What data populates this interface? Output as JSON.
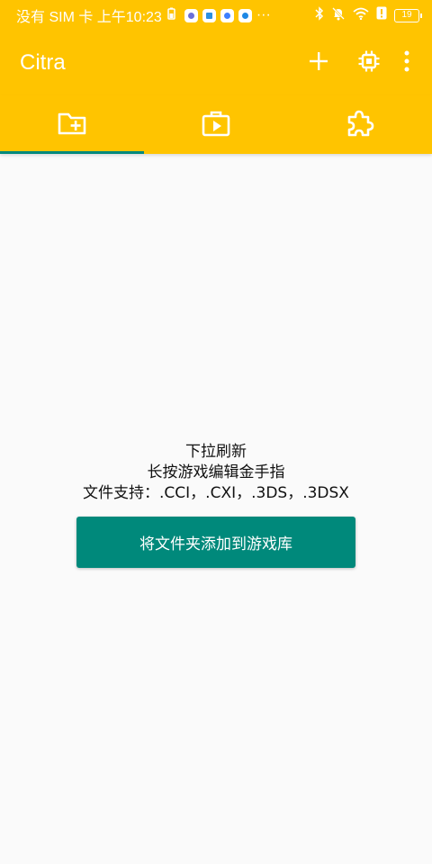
{
  "status_bar": {
    "carrier_time": "没有 SIM 卡 上午10:23",
    "more": "···",
    "battery_level": "19",
    "icons_left": [
      "music-app-icon",
      "book-app-icon",
      "browser-app-icon",
      "bulb-app-icon"
    ],
    "icons_right": [
      "bluetooth-icon",
      "mute-icon",
      "wifi-icon",
      "alert-icon",
      "battery-icon"
    ]
  },
  "app_bar": {
    "title": "Citra",
    "actions": [
      "add-icon",
      "chip-icon",
      "more-vert-icon"
    ]
  },
  "tabs": [
    {
      "name": "tab-games-folder",
      "icon": "folder-add-icon",
      "active": true
    },
    {
      "name": "tab-home",
      "icon": "play-briefcase-icon",
      "active": false
    },
    {
      "name": "tab-addons",
      "icon": "puzzle-icon",
      "active": false
    }
  ],
  "empty_state": {
    "line1": "下拉刷新",
    "line2": "长按游戏编辑金手指",
    "line3": "文件支持：.CCI，.CXI，.3DS，.3DSX"
  },
  "add_folder_button": {
    "label": "将文件夹添加到游戏库"
  },
  "colors": {
    "primary": "#ffc400",
    "accent": "#00897b",
    "background": "#fafafa"
  }
}
